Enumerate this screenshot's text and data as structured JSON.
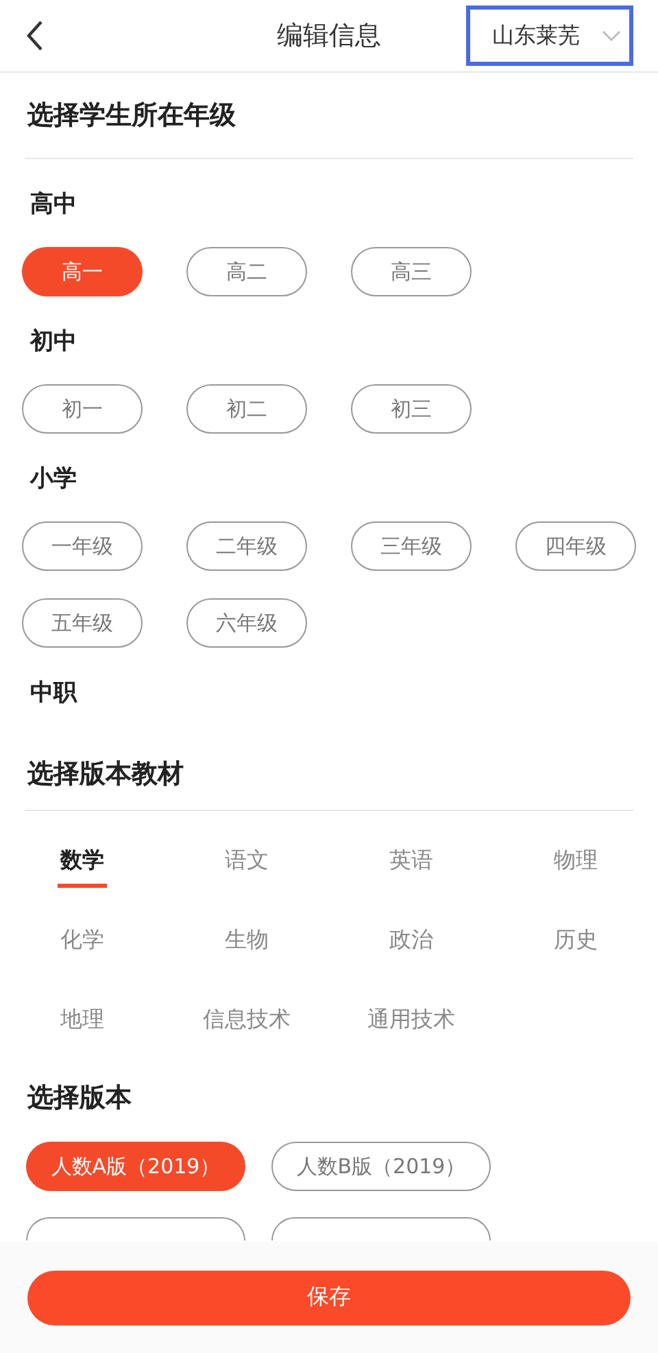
{
  "header": {
    "title": "编辑信息",
    "region": "山东莱芜",
    "region_highlighted": true
  },
  "grade_section": {
    "title": "选择学生所在年级",
    "groups": [
      {
        "label": "高中",
        "grades": [
          {
            "label": "高一",
            "selected": true
          },
          {
            "label": "高二",
            "selected": false
          },
          {
            "label": "高三",
            "selected": false
          }
        ]
      },
      {
        "label": "初中",
        "grades": [
          {
            "label": "初一",
            "selected": false
          },
          {
            "label": "初二",
            "selected": false
          },
          {
            "label": "初三",
            "selected": false
          }
        ]
      },
      {
        "label": "小学",
        "grades": [
          {
            "label": "一年级",
            "selected": false
          },
          {
            "label": "二年级",
            "selected": false
          },
          {
            "label": "三年级",
            "selected": false
          },
          {
            "label": "四年级",
            "selected": false
          },
          {
            "label": "五年级",
            "selected": false
          },
          {
            "label": "六年级",
            "selected": false
          }
        ]
      },
      {
        "label": "中职"
      }
    ]
  },
  "textbook_section": {
    "title": "选择版本教材",
    "subjects": [
      {
        "label": "数学",
        "selected": true
      },
      {
        "label": "语文",
        "selected": false
      },
      {
        "label": "英语",
        "selected": false
      },
      {
        "label": "物理",
        "selected": false
      },
      {
        "label": "化学",
        "selected": false
      },
      {
        "label": "生物",
        "selected": false
      },
      {
        "label": "政治",
        "selected": false
      },
      {
        "label": "历史",
        "selected": false
      },
      {
        "label": "地理",
        "selected": false
      },
      {
        "label": "信息技术",
        "selected": false
      },
      {
        "label": "通用技术",
        "selected": false
      }
    ]
  },
  "edition_section": {
    "title": "选择版本",
    "editions": [
      {
        "label": "人数A版（2019）",
        "selected": true
      },
      {
        "label": "人数B版（2019）",
        "selected": false
      }
    ],
    "hidden_editions": [
      {
        "selected": false
      },
      {
        "selected": false
      }
    ]
  },
  "footer": {
    "save_button": "保存"
  }
}
